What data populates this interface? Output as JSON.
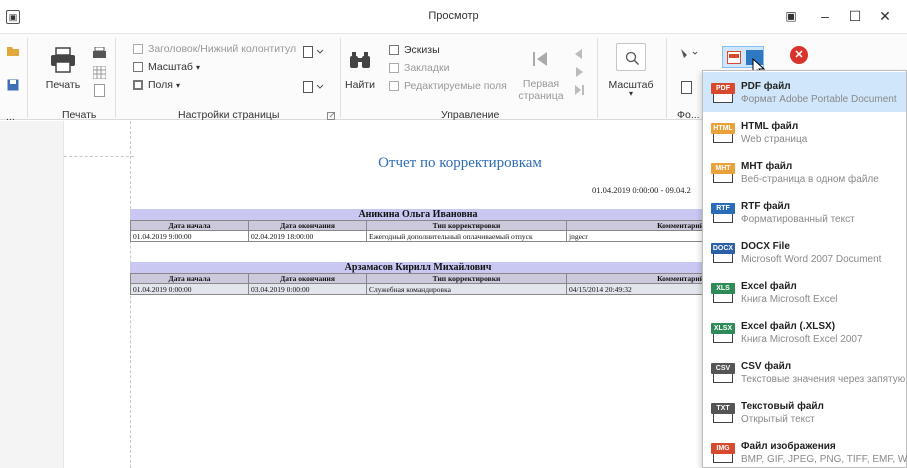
{
  "window": {
    "title": "Просмотр",
    "minimize": "–",
    "maximize": "☐",
    "close": "✕",
    "ribbon_toggle": "▣"
  },
  "ribbon": {
    "print_group": {
      "print_label": "Печать",
      "caption": "Печать"
    },
    "page_setup": {
      "header_footer": "Заголовок/Нижний колонтитул",
      "scale": "Масштаб",
      "margins": "Поля",
      "caption": "Настройки страницы"
    },
    "navigation": {
      "find_label": "Найти",
      "thumbnails": "Эскизы",
      "bookmarks": "Закладки",
      "editable_fields": "Редактируемые поля",
      "first_page": "Первая страница",
      "caption": "Управление"
    },
    "zoom": {
      "label": "Масштаб"
    },
    "background": {
      "caption": "Фо..."
    },
    "more_label": "..."
  },
  "report": {
    "title": "Отчет по корректировкам",
    "period": "01.04.2019 0:00:00 - 09.04.2",
    "columns": [
      "Дата начала",
      "Дата окончания",
      "Тип корректировки",
      "Комментарий"
    ],
    "employees": [
      {
        "name": "Аникина Ольга Ивановна",
        "rows": [
          [
            "01.04.2019 9:00:00",
            "02.04.2019 18:00:00",
            "Ежегодный дополнительный оплачиваемый отпуск",
            "jngecr"
          ]
        ]
      },
      {
        "name": "Арзамасов Кирилл Михайлович",
        "rows": [
          [
            "01.04.2019 0:00:00",
            "03.04.2019 0:00:00",
            "Служебная командировка",
            "04/15/2014 20:49:32"
          ]
        ]
      }
    ]
  },
  "export_menu": [
    {
      "badge": "PDF",
      "color": "#d84a2e",
      "title": "PDF файл",
      "subtitle": "Формат Adobe Portable Document",
      "highlighted": true
    },
    {
      "badge": "HTML",
      "color": "#e9a23b",
      "title": "HTML файл",
      "subtitle": "Web страница",
      "highlighted": false
    },
    {
      "badge": "MHT",
      "color": "#e9a23b",
      "title": "MHT файл",
      "subtitle": "Веб-страница в одном файле",
      "highlighted": false
    },
    {
      "badge": "RTF",
      "color": "#2b6cb8",
      "title": "RTF файл",
      "subtitle": "Форматированный текст",
      "highlighted": false
    },
    {
      "badge": "DOCX",
      "color": "#2b5fa8",
      "title": "DOCX File",
      "subtitle": "Microsoft Word 2007 Document",
      "highlighted": false
    },
    {
      "badge": "XLS",
      "color": "#2e8b57",
      "title": "Excel файл",
      "subtitle": "Книга Microsoft Excel",
      "highlighted": false
    },
    {
      "badge": "XLSX",
      "color": "#2e8b57",
      "title": "Excel файл (.XLSX)",
      "subtitle": "Книга Microsoft Excel 2007",
      "highlighted": false
    },
    {
      "badge": "CSV",
      "color": "#555555",
      "title": "CSV файл",
      "subtitle": "Текстовые значения через запятую",
      "highlighted": false
    },
    {
      "badge": "TXT",
      "color": "#555555",
      "title": "Текстовый файл",
      "subtitle": "Открытый текст",
      "highlighted": false
    },
    {
      "badge": "IMG",
      "color": "#d84a2e",
      "title": "Файл изображения",
      "subtitle": "BMP, GIF, JPEG, PNG, TIFF, EMF, WMF",
      "highlighted": false
    }
  ]
}
